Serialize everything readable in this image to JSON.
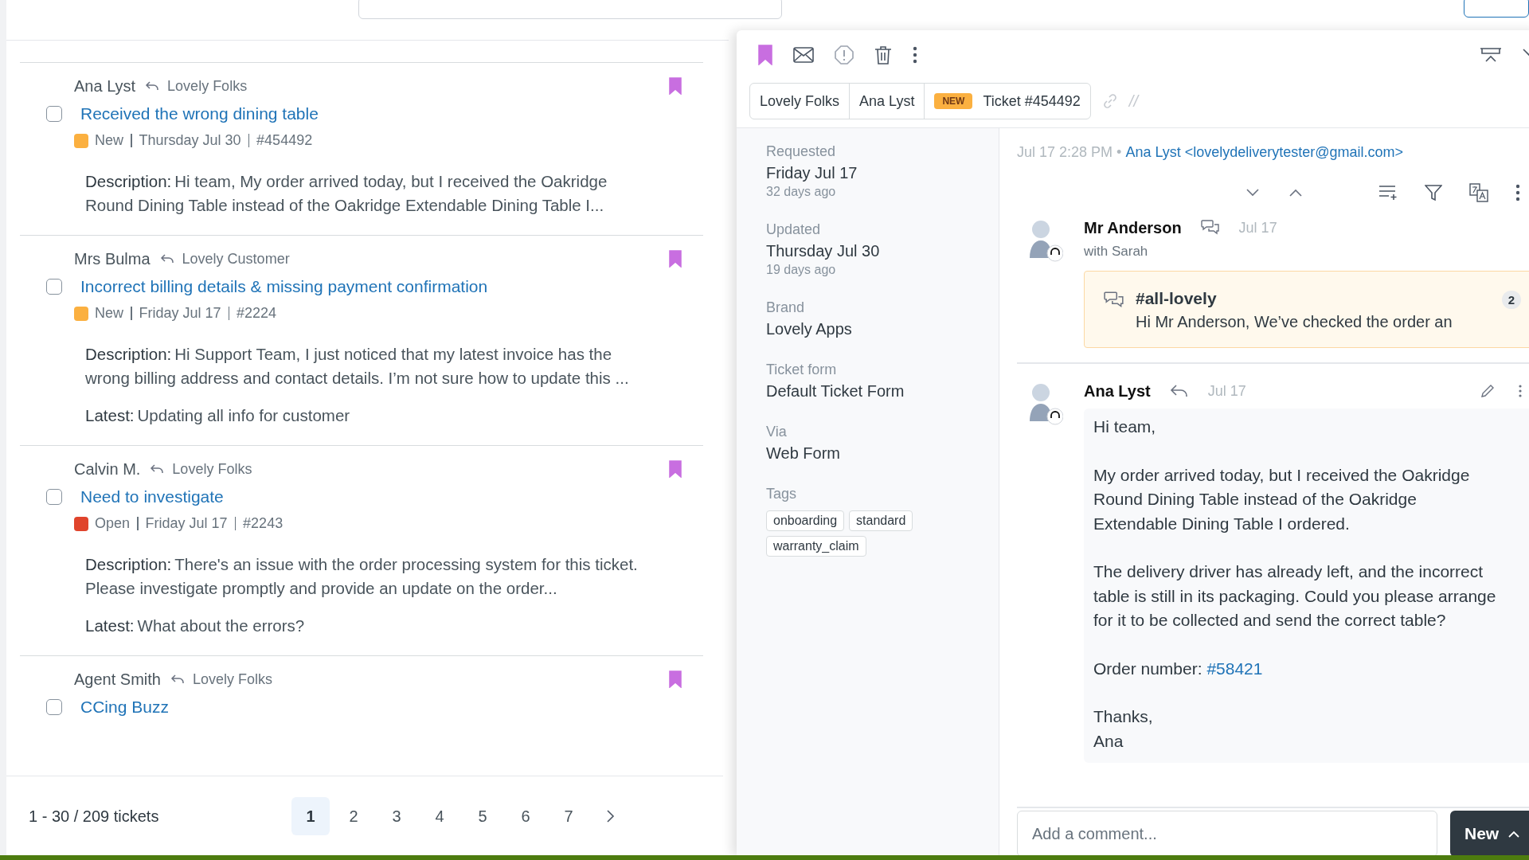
{
  "list": {
    "tickets": [
      {
        "requester": "Ana Lyst",
        "org": "Lovely Folks",
        "title": "Received the wrong dining table",
        "checked": false,
        "bookmarked": true,
        "status": "New",
        "color": "#fbb040",
        "date": "Thursday Jul 30",
        "number": "#454492",
        "description_label": "Description:",
        "description": "Hi team, My order arrived today, but I received the Oakridge Round Dining Table instead of the Oakridge Extendable Dining Table I..."
      },
      {
        "requester": "Mrs Bulma",
        "org": "Lovely Customer",
        "title": "Incorrect billing details & missing payment confirmation",
        "checked": false,
        "bookmarked": true,
        "status": "New",
        "color": "#fbb040",
        "date": "Friday Jul 17",
        "number": "#2224",
        "description_label": "Description:",
        "description": "Hi Support Team, I just noticed that my latest invoice has the wrong billing address and contact details. I’m not sure how to update this ...",
        "latest_label": "Latest:",
        "latest": "Updating all info for customer"
      },
      {
        "requester": "Calvin M.",
        "org": "Lovely Folks",
        "title": "Need to investigate",
        "checked": false,
        "bookmarked": true,
        "status": "Open",
        "color": "#e0442c",
        "date": "Friday Jul 17",
        "number": "#2243",
        "description_label": "Description:",
        "description": "There's an issue with the order processing system for this ticket. Please investigate promptly and provide an update on the order...",
        "latest_label": "Latest:",
        "latest": "What about the errors?"
      },
      {
        "requester": "Agent Smith",
        "org": "Lovely Folks",
        "title": "CCing Buzz",
        "checked": false,
        "bookmarked": true
      }
    ],
    "pagination": {
      "summary": "1 - 30 / 209 tickets",
      "pages": [
        {
          "label": "1",
          "selected": true
        },
        {
          "label": "2",
          "selected": false
        },
        {
          "label": "3",
          "selected": false
        },
        {
          "label": "4",
          "selected": false
        },
        {
          "label": "5",
          "selected": false
        },
        {
          "label": "6",
          "selected": false
        },
        {
          "label": "7",
          "selected": false
        }
      ]
    }
  },
  "ticket": {
    "bookmarked": true,
    "breadcrumbs": [
      "Lovely Folks",
      "Ana Lyst"
    ],
    "status_badge": "NEW",
    "ticket_label": "Ticket #454492",
    "separator": "//",
    "fields": [
      {
        "label": "Requested",
        "value": "Friday Jul 17",
        "sub": "32 days ago"
      },
      {
        "label": "Updated",
        "value": "Thursday Jul 30",
        "sub": "19 days ago"
      },
      {
        "label": "Brand",
        "value": "Lovely Apps"
      },
      {
        "label": "Ticket form",
        "value": "Default Ticket Form"
      },
      {
        "label": "Via",
        "value": "Web Form"
      }
    ],
    "tags_label": "Tags",
    "tags": [
      "onboarding",
      "standard",
      "warranty_claim"
    ],
    "header": {
      "time": "Jul 17 2:28 PM •",
      "from": "Ana Lyst <lovelydeliverytester@gmail.com>"
    },
    "messages": [
      {
        "kind": "side_conversation",
        "author": "Mr Anderson",
        "date": "Jul 17",
        "with": "with Sarah",
        "channel": "#all-lovely",
        "preview": "Hi Mr Anderson, We’ve checked the order an",
        "count": "2"
      },
      {
        "kind": "reply",
        "author": "Ana Lyst",
        "date": "Jul 17",
        "paragraphs": [
          {
            "text": "Hi team,"
          },
          {
            "text": "My order arrived today, but I received the Oakridge Round Dining Table instead of the Oakridge Extendable Dining Table I ordered."
          },
          {
            "text": "The delivery driver has already left, and the incorrect table is still in its packaging. Could you please arrange for it to be collected and send the correct table?"
          },
          {
            "text": "Order number:",
            "link": "#58421"
          },
          {
            "text": "Thanks,\nAna"
          }
        ]
      }
    ],
    "comment": {
      "placeholder": "Add a comment..."
    },
    "submit": "New"
  }
}
